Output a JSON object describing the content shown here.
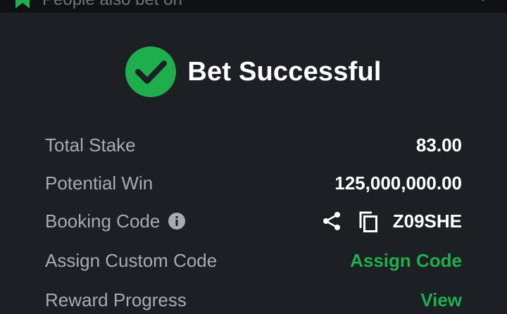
{
  "topbar": {
    "title": "People also bet on",
    "icons": {
      "left": "bookmark-icon",
      "right": "chevron-down-icon"
    }
  },
  "success": {
    "title": "Bet Successful",
    "icon": "check-circle-icon"
  },
  "details": {
    "total_stake_label": "Total Stake",
    "total_stake_value": "83.00",
    "potential_win_label": "Potential Win",
    "potential_win_value": "125,000,000.00",
    "booking_code_label": "Booking Code",
    "booking_code_value": "Z09SHE",
    "assign_custom_code_label": "Assign Custom Code",
    "assign_code_action": "Assign Code",
    "reward_progress_label": "Reward Progress",
    "reward_progress_action": "View"
  },
  "colors": {
    "background": "#1c1f24",
    "topbar": "#0f1114",
    "accent_green": "#1fae4c",
    "label_gray": "#a7abb2",
    "text_white": "#ffffff"
  }
}
